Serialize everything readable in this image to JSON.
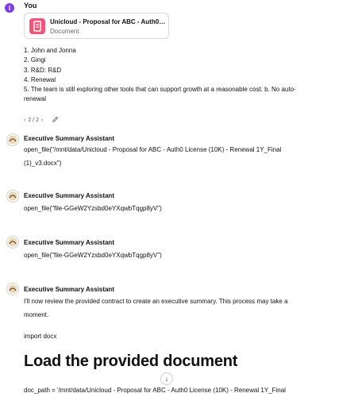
{
  "user": {
    "initial": "I",
    "name": "You",
    "attachment": {
      "title": "Unicloud - Proposal for ABC - Auth0 Lic...",
      "type": "Document"
    },
    "lines": [
      "1. John and Jonna",
      "2. Gingi",
      "3. R&D: R&D",
      "4. Renewal",
      "5. The team is still exploring other tools that can support growth at a reasonable cost. b. No auto-",
      "renewal"
    ],
    "pager": {
      "prev": "‹",
      "label": "2 / 2",
      "next": "›"
    }
  },
  "assistant_name": "Executive Summary Assistant",
  "messages": [
    {
      "text1": "open_file(\"/mnt/data/Unicloud - Proposal for ABC - Auth0 License (10K) - Renewal 1Y_Final",
      "text2": "(1)_v3.docx\")"
    },
    {
      "text1": "open_file(\"file-GGeW2Yzsbd0eYXqwbTqgp8yV\")"
    },
    {
      "text1": "open_file(\"file-GGeW2Yzsbd0eYXqwbTqgp8yV\")"
    },
    {
      "text1": "I'll now review the provided contract to create an executive summary. This process may take a",
      "text2": "moment.",
      "code": "import docx",
      "heading": "Load the provided document",
      "path": "doc_path = '/mnt/data/Unicloud - Proposal for ABC - Auth0 License (10K) - Renewal 1Y_Final"
    }
  ]
}
